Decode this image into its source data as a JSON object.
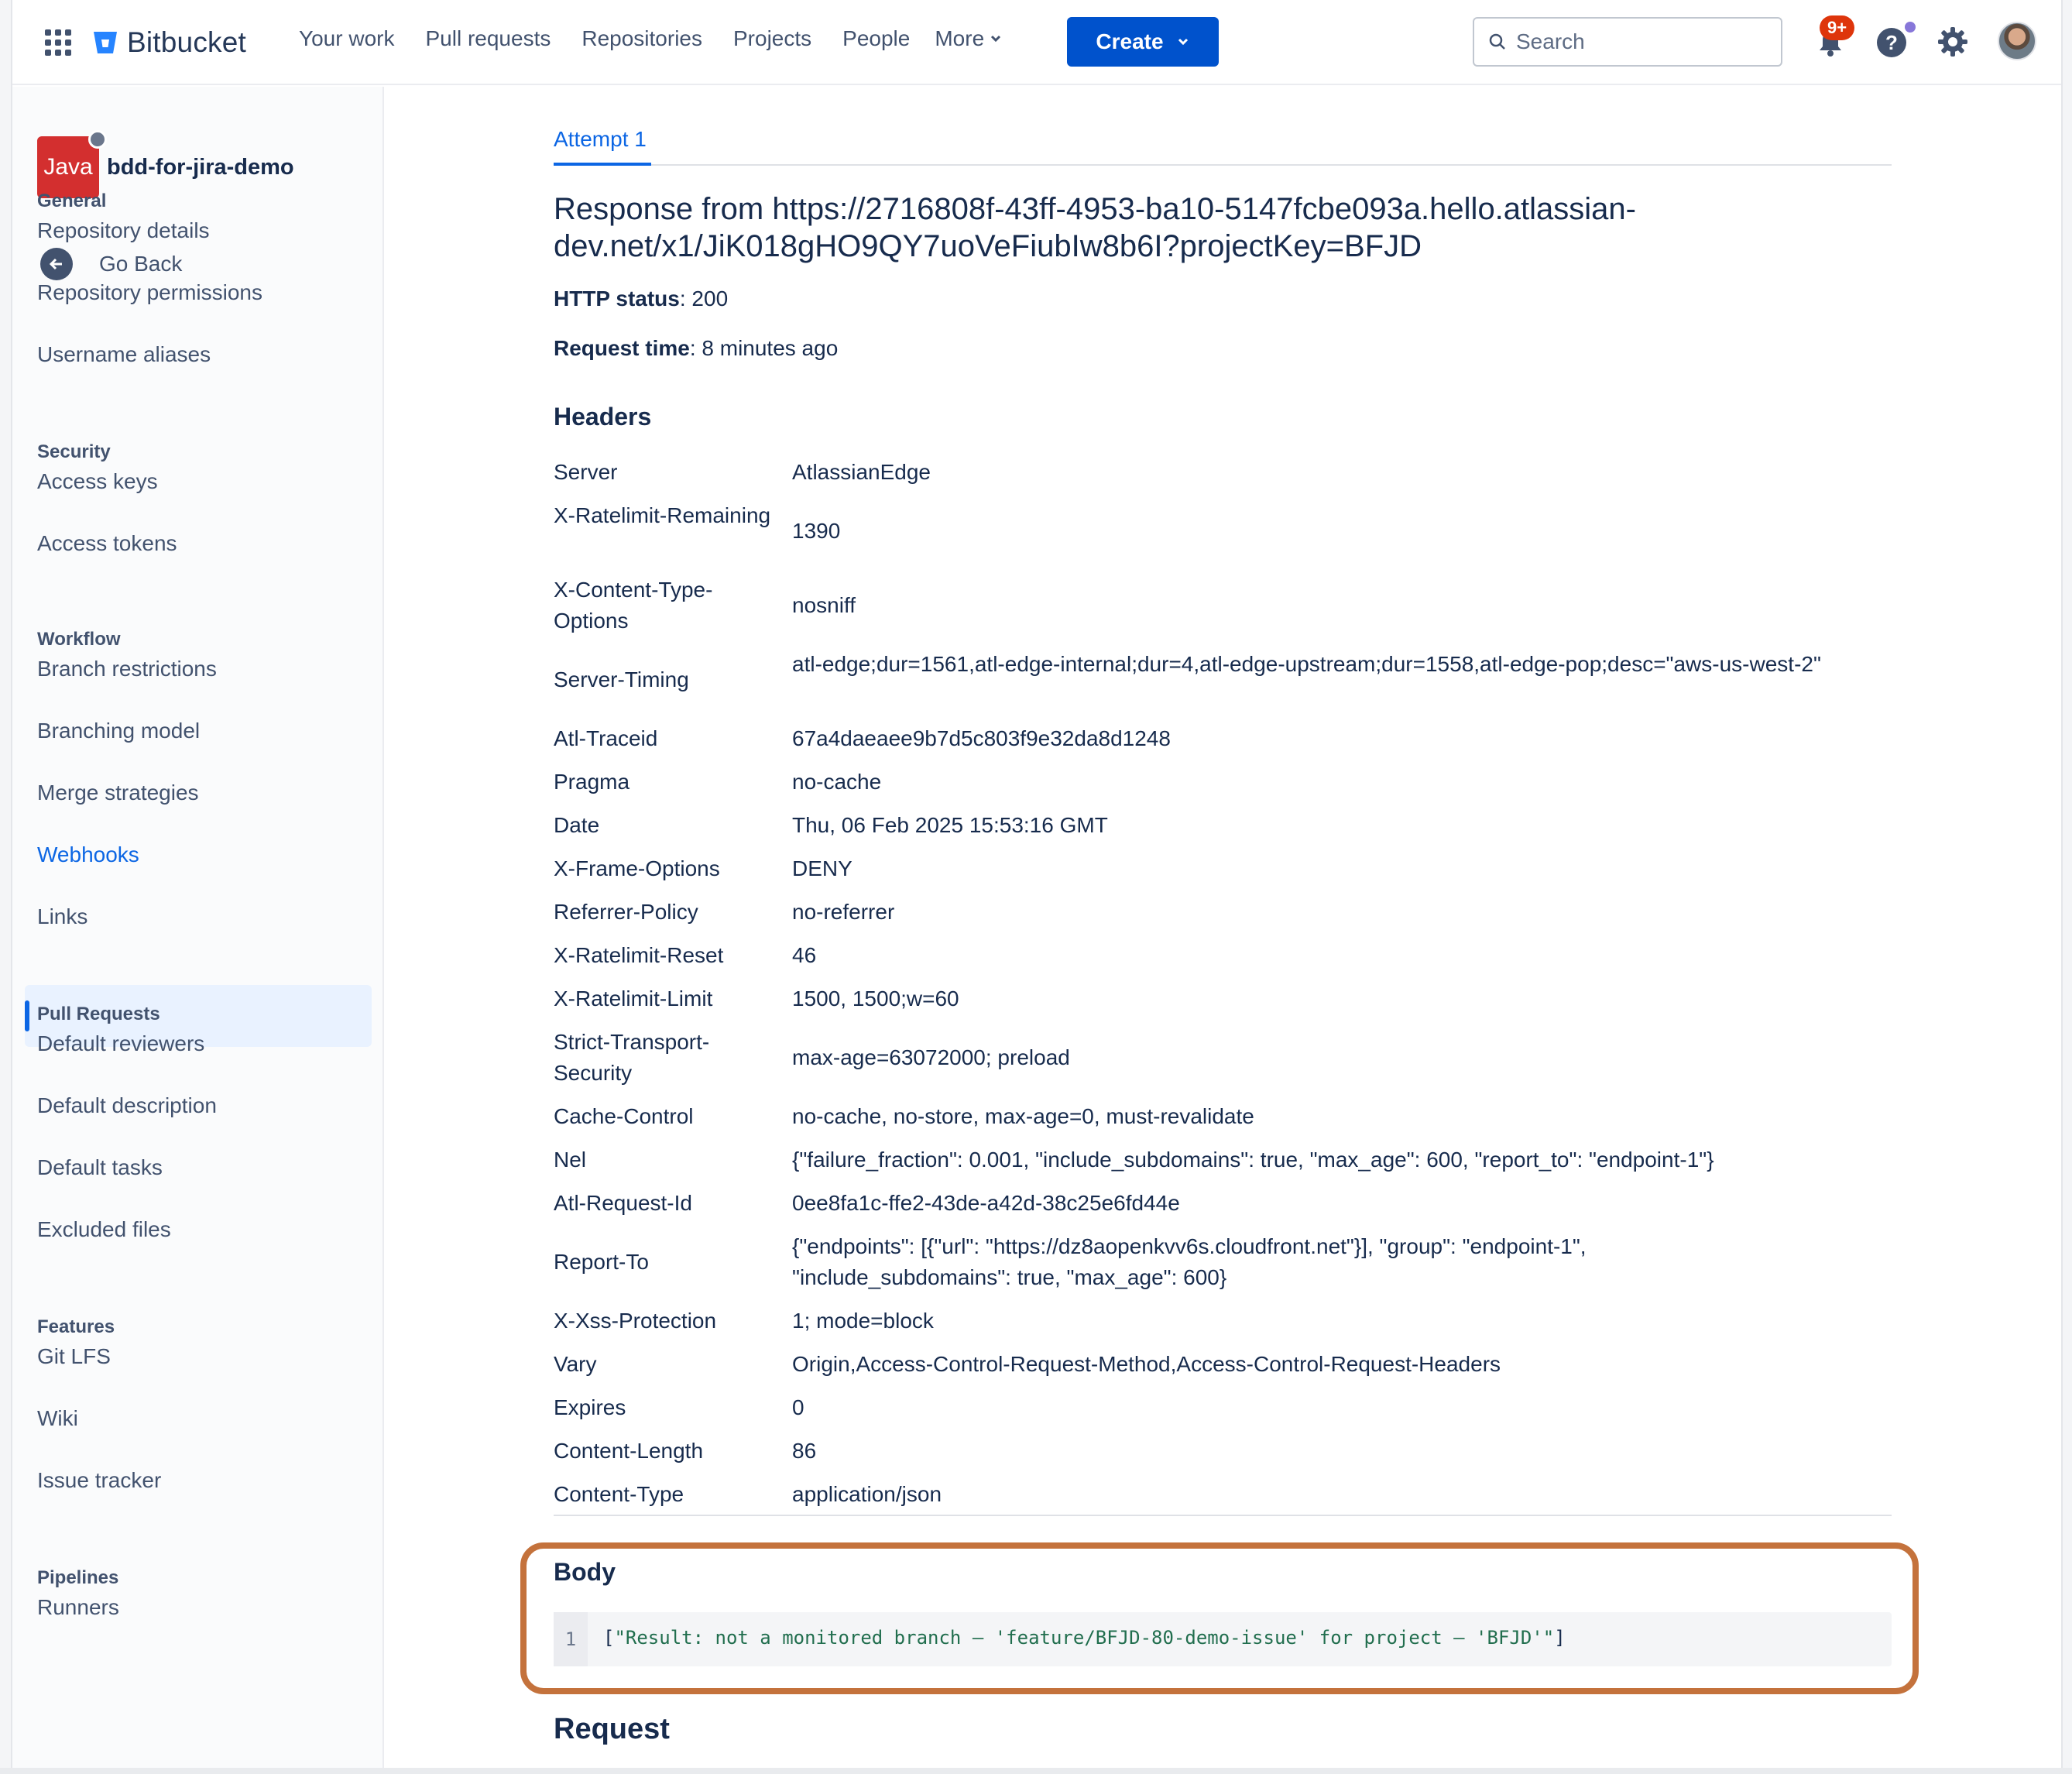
{
  "topnav": {
    "brand": "Bitbucket",
    "links": [
      "Your work",
      "Pull requests",
      "Repositories",
      "Projects",
      "People"
    ],
    "more_label": "More",
    "create_label": "Create",
    "search_placeholder": "Search",
    "notifications_badge": "9+"
  },
  "sidebar": {
    "repo_avatar_text": "Java",
    "repo_name": "bdd-for-jira-demo",
    "go_back": "Go Back",
    "sections": {
      "general": "General",
      "security": "Security",
      "workflow": "Workflow",
      "pull_requests": "Pull Requests",
      "features": "Features",
      "pipelines": "Pipelines"
    },
    "items": {
      "repo_details": "Repository details",
      "repo_permissions": "Repository permissions",
      "username_aliases": "Username aliases",
      "access_keys": "Access keys",
      "access_tokens": "Access tokens",
      "branch_restrictions": "Branch restrictions",
      "branching_model": "Branching model",
      "merge_strategies": "Merge strategies",
      "webhooks": "Webhooks",
      "links": "Links",
      "default_reviewers": "Default reviewers",
      "default_description": "Default description",
      "default_tasks": "Default tasks",
      "excluded_files": "Excluded files",
      "git_lfs": "Git LFS",
      "wiki": "Wiki",
      "issue_tracker": "Issue tracker",
      "runners": "Runners"
    }
  },
  "main": {
    "tab_label": "Attempt 1",
    "response_title_line1": "Response from https://2716808f-43ff-4953-ba10-5147fcbe093a.hello.atlassian-",
    "response_title_line2": "dev.net/x1/JiK018gHO9QY7uoVeFiubIw8b6I?projectKey=BFJD",
    "http_status_label": "HTTP status",
    "http_status_value": ": 200",
    "request_time_label": "Request time",
    "request_time_value": ": 8 minutes ago",
    "headers_title": "Headers",
    "headers": [
      {
        "key": "Server",
        "value": "AtlassianEdge"
      },
      {
        "key": "X-Ratelimit-Remaining",
        "value": "1390"
      },
      {
        "key": "X-Content-Type-Options",
        "value": "nosniff"
      },
      {
        "key": "Server-Timing",
        "value": "atl-edge;dur=1561,atl-edge-internal;dur=4,atl-edge-upstream;dur=1558,atl-edge-pop;desc=\"aws-us-west-2\""
      },
      {
        "key": "Atl-Traceid",
        "value": "67a4daeaee9b7d5c803f9e32da8d1248"
      },
      {
        "key": "Pragma",
        "value": "no-cache"
      },
      {
        "key": "Date",
        "value": "Thu, 06 Feb 2025 15:53:16 GMT"
      },
      {
        "key": "X-Frame-Options",
        "value": "DENY"
      },
      {
        "key": "Referrer-Policy",
        "value": "no-referrer"
      },
      {
        "key": "X-Ratelimit-Reset",
        "value": "46"
      },
      {
        "key": "X-Ratelimit-Limit",
        "value": "1500, 1500;w=60"
      },
      {
        "key": "Strict-Transport-Security",
        "value": "max-age=63072000; preload"
      },
      {
        "key": "Cache-Control",
        "value": "no-cache, no-store, max-age=0, must-revalidate"
      },
      {
        "key": "Nel",
        "value": "{\"failure_fraction\": 0.001, \"include_subdomains\": true, \"max_age\": 600, \"report_to\": \"endpoint-1\"}"
      },
      {
        "key": "Atl-Request-Id",
        "value": "0ee8fa1c-ffe2-43de-a42d-38c25e6fd44e"
      },
      {
        "key": "Report-To",
        "value": "{\"endpoints\": [{\"url\": \"https://dz8aopenkvv6s.cloudfront.net\"}], \"group\": \"endpoint-1\", \"include_subdomains\": true, \"max_age\": 600}"
      },
      {
        "key": "X-Xss-Protection",
        "value": "1; mode=block"
      },
      {
        "key": "Vary",
        "value": "Origin,Access-Control-Request-Method,Access-Control-Request-Headers"
      },
      {
        "key": "Expires",
        "value": "0"
      },
      {
        "key": "Content-Length",
        "value": "86"
      },
      {
        "key": "Content-Type",
        "value": "application/json"
      }
    ],
    "body_title": "Body",
    "body_line_number": "1",
    "body_open": "[",
    "body_string": "\"Result: not a monitored branch – 'feature/BFJD-80-demo-issue' for project – 'BFJD'\"",
    "body_close": "]",
    "request_title": "Request"
  },
  "colors": {
    "accent": "#0052cc",
    "highlight": "#c4723c",
    "badge": "#de350b"
  }
}
